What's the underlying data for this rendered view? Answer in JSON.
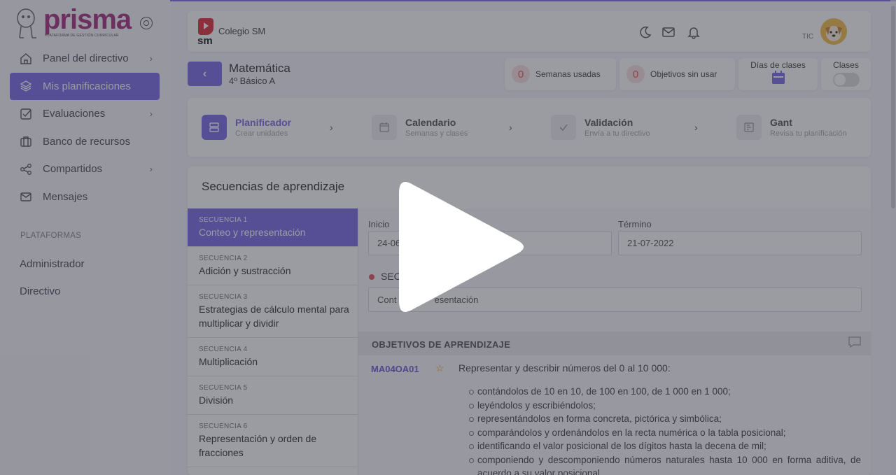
{
  "brand": {
    "name": "prisma",
    "tagline": "PLATAFORMA DE GESTIÓN CURRICULAR",
    "color": "#a7307f"
  },
  "sidebar": {
    "items": [
      {
        "label": "Panel del directivo",
        "icon": "home-icon",
        "has_submenu": true
      },
      {
        "label": "Mis planificaciones",
        "icon": "layers-icon",
        "active": true
      },
      {
        "label": "Evaluaciones",
        "icon": "checkbox-icon",
        "has_submenu": true
      },
      {
        "label": "Banco de recursos",
        "icon": "briefcase-icon"
      },
      {
        "label": "Compartidos",
        "icon": "share-icon",
        "has_submenu": true
      },
      {
        "label": "Mensajes",
        "icon": "mail-icon"
      }
    ],
    "section_title": "PLATAFORMAS",
    "links": [
      "Administrador",
      "Directivo"
    ]
  },
  "topbar": {
    "logo_text": "sm",
    "school": "Colegio SM",
    "user_tag": "TIC"
  },
  "header": {
    "subject": "Matemática",
    "course": "4º Básico A"
  },
  "stats": {
    "weeks": {
      "value": "0",
      "label": "Semanas usadas"
    },
    "objectives": {
      "value": "0",
      "label": "Objetivos sin usar"
    },
    "days_label": "Días de clases",
    "classes_label": "Clases"
  },
  "steps": [
    {
      "title": "Planificador",
      "subtitle": "Crear unidades",
      "active": true
    },
    {
      "title": "Calendario",
      "subtitle": "Semanas y clases"
    },
    {
      "title": "Validación",
      "subtitle": "Envía a tu directivo"
    },
    {
      "title": "Gant",
      "subtitle": "Revisa tu planificación"
    }
  ],
  "sequences_title": "Secuencias de aprendizaje",
  "sequences": [
    {
      "label": "SECUENCIA 1",
      "name": "Conteo y representación",
      "active": true
    },
    {
      "label": "SECUENCIA 2",
      "name": "Adición y sustracción"
    },
    {
      "label": "SECUENCIA 3",
      "name": "Estrategias de cálculo mental para multiplicar y dividir"
    },
    {
      "label": "SECUENCIA 4",
      "name": "Multiplicación"
    },
    {
      "label": "SECUENCIA 5",
      "name": "División"
    },
    {
      "label": "SECUENCIA 6",
      "name": "Representación y orden de fracciones"
    }
  ],
  "detail": {
    "start_label": "Inicio",
    "start_value": "24-06",
    "end_label": "Término",
    "end_value": "21-07-2022",
    "sequence_label": "SEC",
    "sequence_value_prefix": "Cont",
    "sequence_value_suffix": "esentación",
    "objectives_header": "OBJETIVOS DE APRENDIZAJE",
    "objective_code": "MA04OA01",
    "objective_text": "Representar y describir números del 0 al 10 000:",
    "objective_points": [
      "contándolos de 10 en 10, de 100 en 100, de 1 000 en 1 000;",
      "leyéndolos y escribiéndolos;",
      "representándolos en forma concreta, pictórica y simbólica;",
      "comparándolos y ordenándolos en la recta numérica o la tabla posicional;",
      "identificando el valor posicional de los dígitos hasta la decena de mil;",
      "componiendo y descomponiendo números naturales hasta 10 000 en forma aditiva, de acuerdo a su valor posicional"
    ]
  },
  "colors": {
    "accent": "#7e6ee6",
    "alert": "#e25959",
    "overlay": "#2d2d3c"
  }
}
